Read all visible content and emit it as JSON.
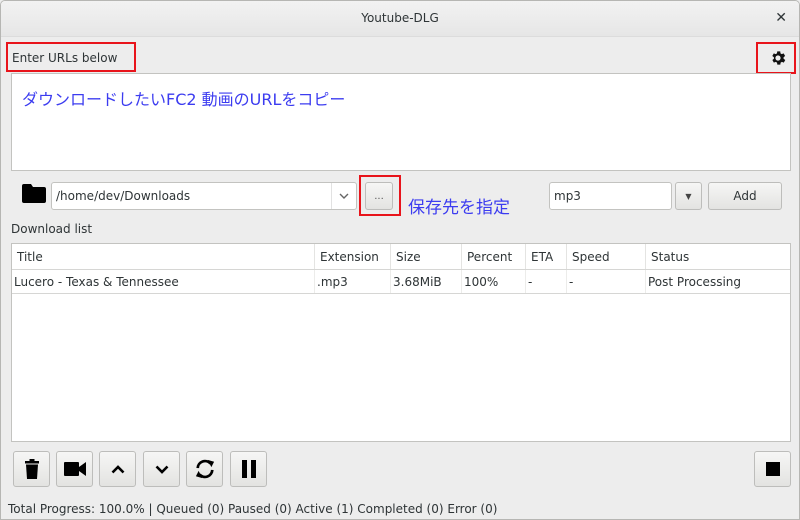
{
  "window": {
    "title": "Youtube-DLG",
    "close_icon": "close-icon"
  },
  "url_section": {
    "label": "Enter URLs below",
    "settings_icon": "gear-icon",
    "textarea_value": "ダウンロードしたいFC2 動画のURLをコピー"
  },
  "path_row": {
    "folder_icon": "folder-icon",
    "path_value": "/home/dev/Downloads",
    "browse_label": "...",
    "annotation_note": "保存先を指定",
    "format_value": "mp3",
    "add_label": "Add"
  },
  "download_list": {
    "label": "Download list",
    "columns": [
      "Title",
      "Extension",
      "Size",
      "Percent",
      "ETA",
      "Speed",
      "Status"
    ],
    "rows": [
      [
        "Lucero - Texas & Tennessee",
        ".mp3",
        "3.68MiB",
        "100%",
        "-",
        "-",
        "Post Processing"
      ]
    ]
  },
  "toolbar": {
    "buttons": [
      {
        "name": "delete",
        "icon": "trash-icon"
      },
      {
        "name": "play",
        "icon": "video-camera-icon"
      },
      {
        "name": "move-up",
        "icon": "chevron-up-icon"
      },
      {
        "name": "move-down",
        "icon": "chevron-down-icon"
      },
      {
        "name": "reload",
        "icon": "refresh-icon"
      },
      {
        "name": "pause",
        "icon": "pause-icon"
      }
    ],
    "stop_icon": "stop-icon"
  },
  "status_bar": {
    "text": "Total Progress: 100.0% | Queued (0) Paused (0) Active (1) Completed (0) Error (0)"
  },
  "colors": {
    "annotation_red": "#e8141b",
    "annotation_text_blue": "#3c3cf0"
  }
}
